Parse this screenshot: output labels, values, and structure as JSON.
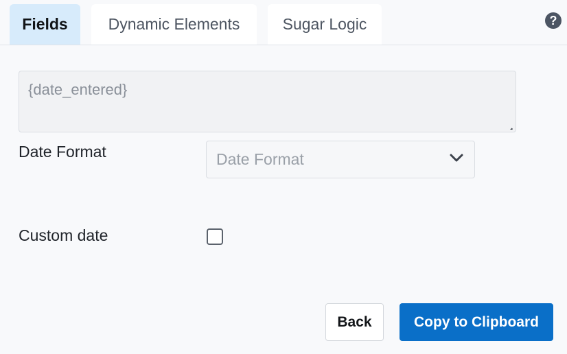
{
  "tabs": [
    {
      "label": "Fields",
      "active": true
    },
    {
      "label": "Dynamic Elements",
      "active": false
    },
    {
      "label": "Sugar Logic",
      "active": false
    }
  ],
  "help": {
    "icon": "question-circle-icon",
    "glyph": "?"
  },
  "preview": {
    "value": "{date_entered}"
  },
  "date_format": {
    "label": "Date Format",
    "placeholder": "Date Format",
    "icon": "chevron-down-icon"
  },
  "custom_date": {
    "label": "Custom date",
    "checked": false
  },
  "buttons": {
    "back_label": "Back",
    "copy_label": "Copy to Clipboard"
  },
  "colors": {
    "active_tab": "#d7ebfb",
    "primary": "#0a6fc8",
    "background": "#f8f9fb"
  }
}
